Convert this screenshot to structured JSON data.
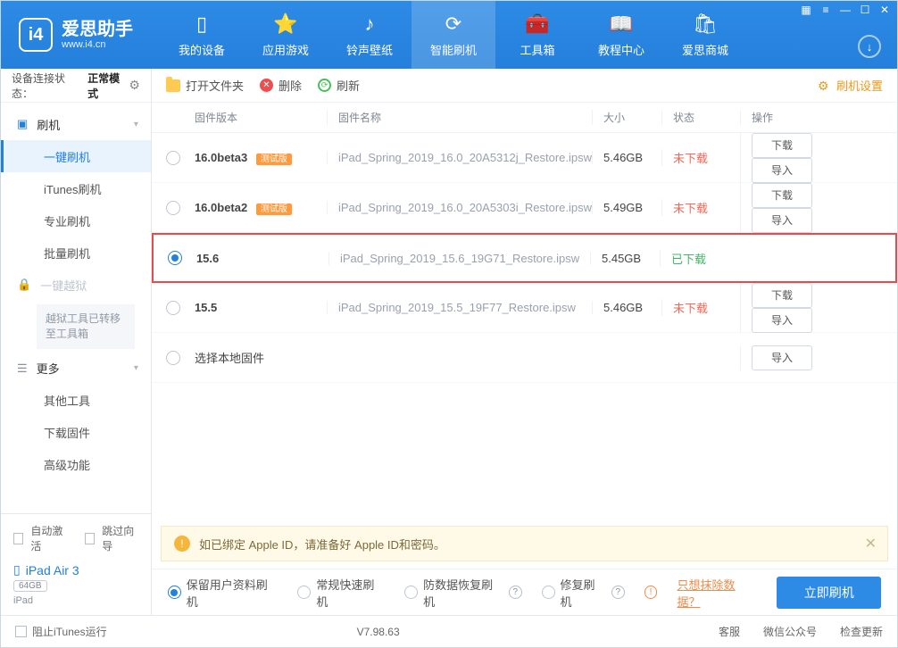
{
  "logo": {
    "title": "爱思助手",
    "sub": "www.i4.cn",
    "icon": "i4"
  },
  "nav": [
    {
      "label": "我的设备"
    },
    {
      "label": "应用游戏"
    },
    {
      "label": "铃声壁纸"
    },
    {
      "label": "智能刷机",
      "active": true
    },
    {
      "label": "工具箱"
    },
    {
      "label": "教程中心"
    },
    {
      "label": "爱思商城"
    }
  ],
  "status": {
    "label": "设备连接状态：",
    "value": "正常模式"
  },
  "sidebar": {
    "cat_flash": "刷机",
    "items_flash": [
      "一键刷机",
      "iTunes刷机",
      "专业刷机",
      "批量刷机"
    ],
    "cat_jb": "一键越狱",
    "jb_note": "越狱工具已转移至工具箱",
    "cat_more": "更多",
    "items_more": [
      "其他工具",
      "下载固件",
      "高级功能"
    ]
  },
  "sb_bottom": {
    "auto_activate": "自动激活",
    "skip_guide": "跳过向导",
    "device_name": "iPad Air 3",
    "capacity": "64GB",
    "device_type": "iPad"
  },
  "toolbar": {
    "open": "打开文件夹",
    "delete": "删除",
    "refresh": "刷新",
    "settings": "刷机设置"
  },
  "columns": {
    "version": "固件版本",
    "name": "固件名称",
    "size": "大小",
    "status": "状态",
    "ops": "操作"
  },
  "rows": [
    {
      "ver": "16.0beta3",
      "beta": "测试版",
      "name": "iPad_Spring_2019_16.0_20A5312j_Restore.ipsw",
      "size": "5.46GB",
      "status": "未下载",
      "downloaded": false,
      "selected": false,
      "highlight": false
    },
    {
      "ver": "16.0beta2",
      "beta": "测试版",
      "name": "iPad_Spring_2019_16.0_20A5303i_Restore.ipsw",
      "size": "5.49GB",
      "status": "未下载",
      "downloaded": false,
      "selected": false,
      "highlight": false
    },
    {
      "ver": "15.6",
      "beta": "",
      "name": "iPad_Spring_2019_15.6_19G71_Restore.ipsw",
      "size": "5.45GB",
      "status": "已下载",
      "downloaded": true,
      "selected": true,
      "highlight": true
    },
    {
      "ver": "15.5",
      "beta": "",
      "name": "iPad_Spring_2019_15.5_19F77_Restore.ipsw",
      "size": "5.46GB",
      "status": "未下载",
      "downloaded": false,
      "selected": false,
      "highlight": false
    }
  ],
  "local_row": "选择本地固件",
  "btn_download": "下载",
  "btn_import": "导入",
  "notice": "如已绑定 Apple ID，请准备好 Apple ID和密码。",
  "options": {
    "o1": "保留用户资料刷机",
    "o2": "常规快速刷机",
    "o3": "防数据恢复刷机",
    "o4": "修复刷机",
    "erase_link": "只想抹除数据？",
    "flash": "立即刷机"
  },
  "footer": {
    "block_itunes": "阻止iTunes运行",
    "version": "V7.98.63",
    "links": [
      "客服",
      "微信公众号",
      "检查更新"
    ]
  }
}
